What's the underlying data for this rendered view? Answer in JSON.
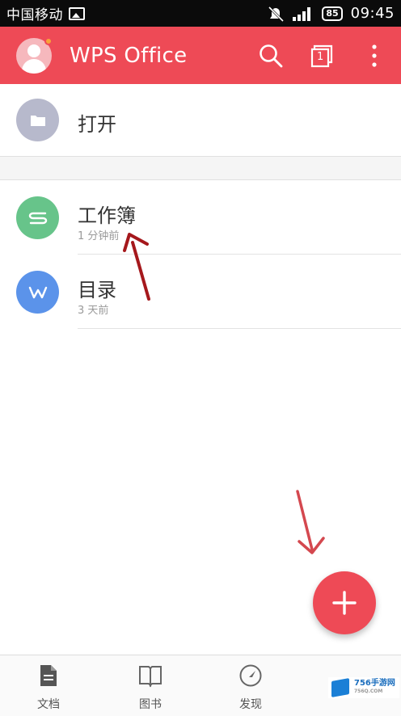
{
  "status_bar": {
    "carrier": "中国移动",
    "battery": "85",
    "time": "09:45"
  },
  "app_bar": {
    "title": "WPS Office",
    "page_count_badge": "1",
    "icons": [
      "avatar",
      "search-icon",
      "tabs-icon",
      "more-vertical-icon"
    ]
  },
  "open_item": {
    "label": "打开",
    "icon": "folder-icon",
    "color": "#b7b9cc"
  },
  "recent_files": [
    {
      "name": "工作簿",
      "time": "1 分钟前",
      "icon_letter": "S",
      "color": "#67c48a"
    },
    {
      "name": "目录",
      "time": "3 天前",
      "icon_letter": "W",
      "color": "#5b93ea"
    }
  ],
  "fab": {
    "icon": "plus-icon",
    "color": "#ee4a56"
  },
  "bottom_nav": [
    {
      "label": "文档",
      "icon": "document-icon"
    },
    {
      "label": "图书",
      "icon": "book-icon"
    },
    {
      "label": "发现",
      "icon": "compass-icon"
    }
  ],
  "watermark": {
    "text": "756手游网",
    "subtext": "756Q.COM"
  },
  "colors": {
    "accent": "#ee4a56",
    "background": "#f5f5f5",
    "annotation_arrow": "#a5181c"
  }
}
